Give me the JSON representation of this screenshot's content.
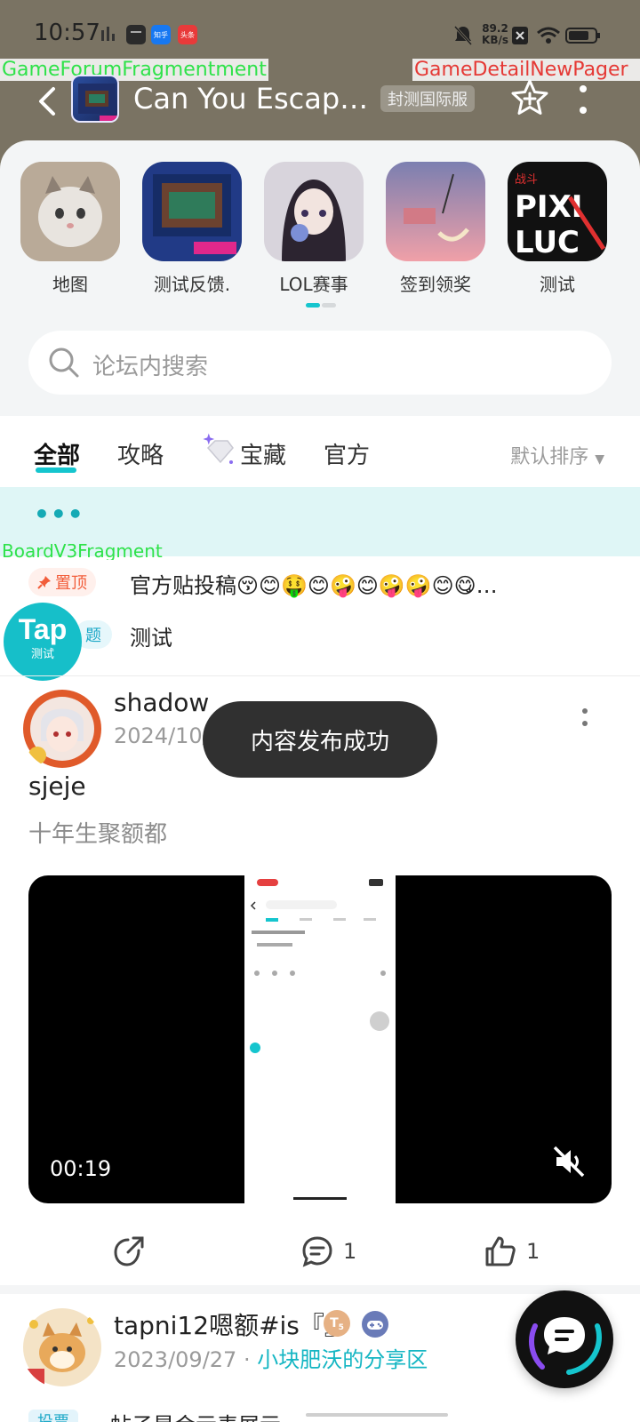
{
  "status_bar": {
    "time": "10:57",
    "net_speed_value": "89.2",
    "net_speed_unit": "KB/s",
    "app_badge_1": "知乎",
    "app_badge_2": "头条"
  },
  "debug_labels": {
    "forum_fragment": "GameForumFragment",
    "forum_fragment_tail": "ment",
    "detail_pager": "GameDetailNewPager",
    "board_fragment": "BoardV3Fragment"
  },
  "header": {
    "title": "Can You Escape…",
    "server_badge": "封测国际服"
  },
  "sections": [
    {
      "label": "地图",
      "icon": "cat-photo"
    },
    {
      "label": "测试反馈.",
      "icon": "game-room"
    },
    {
      "label": "LOL赛事",
      "icon": "anime-girl"
    },
    {
      "label": "签到领奖",
      "icon": "pink-sky"
    },
    {
      "label": "测试",
      "icon": "pixel-logo"
    }
  ],
  "search": {
    "placeholder": "论坛内搜索"
  },
  "tabs": [
    {
      "label": "全部",
      "active": true
    },
    {
      "label": "攻略",
      "active": false
    },
    {
      "label": "宝藏",
      "active": false
    },
    {
      "label": "官方",
      "active": false
    }
  ],
  "sort_label": "默认排序",
  "banner_text": "•••",
  "pinned": [
    {
      "tag": "置顶",
      "text": "官方贴投稿😚😊🤑😊🤪😊🤪🤪😊😋…"
    },
    {
      "tag": "题",
      "text": "测试"
    }
  ],
  "floating_tap": {
    "big": "Tap",
    "small": "测试"
  },
  "posts": [
    {
      "author": "shadow",
      "date": "2024/10/",
      "title": "sjeje",
      "subtitle": "十年生聚额都",
      "video_time": "00:19",
      "share_count": "",
      "comment_count": "1",
      "like_count": "1"
    },
    {
      "author": "tapni12嗯额#is『』",
      "date": "2023/09/27",
      "category": "小块肥沃的分享区",
      "level": "5",
      "vote_tag": "投票",
      "preview": "帖子是会示表展示"
    }
  ],
  "toast": "内容发布成功",
  "colors": {
    "accent": "#15c5ce",
    "hero_bg": "#7a7363",
    "pin_red": "#f25d3a"
  }
}
